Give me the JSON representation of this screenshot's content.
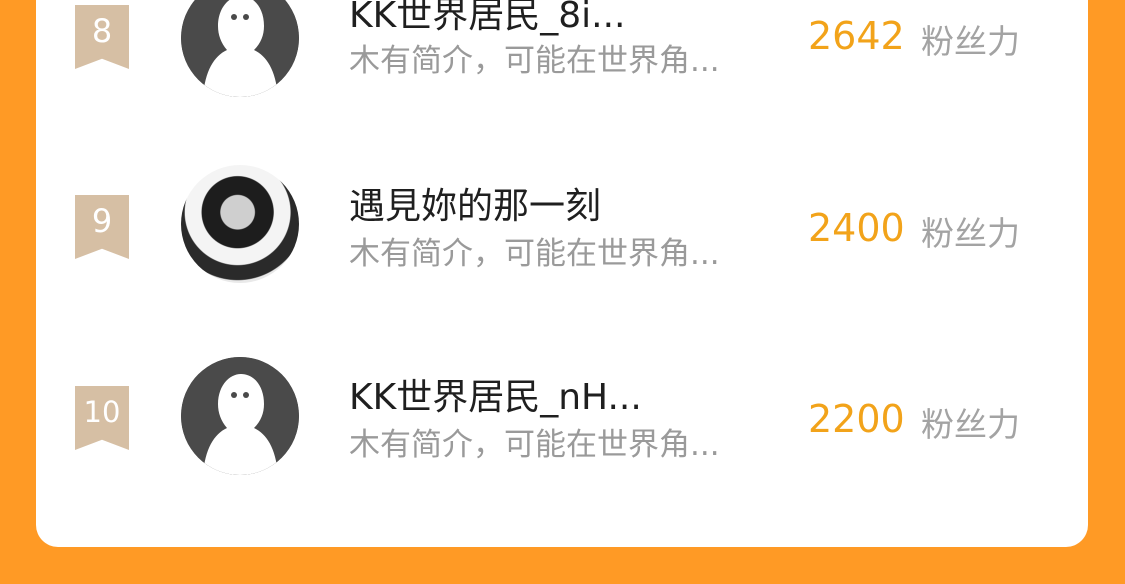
{
  "list": {
    "items": [
      {
        "rank": "8",
        "name": "KK世界居民_8i...",
        "bio": "木有简介，可能在世界角...",
        "score": "2642",
        "score_label": "粉丝力"
      },
      {
        "rank": "9",
        "name": "遇見妳的那一刻",
        "bio": "木有简介，可能在世界角...",
        "score": "2400",
        "score_label": "粉丝力"
      },
      {
        "rank": "10",
        "name": "KK世界居民_nH...",
        "bio": "木有简介，可能在世界角...",
        "score": "2200",
        "score_label": "粉丝力"
      }
    ]
  },
  "icons": {
    "default_avatar": "ghost-avatar-icon",
    "rank_badge": "rank-ribbon-icon"
  }
}
